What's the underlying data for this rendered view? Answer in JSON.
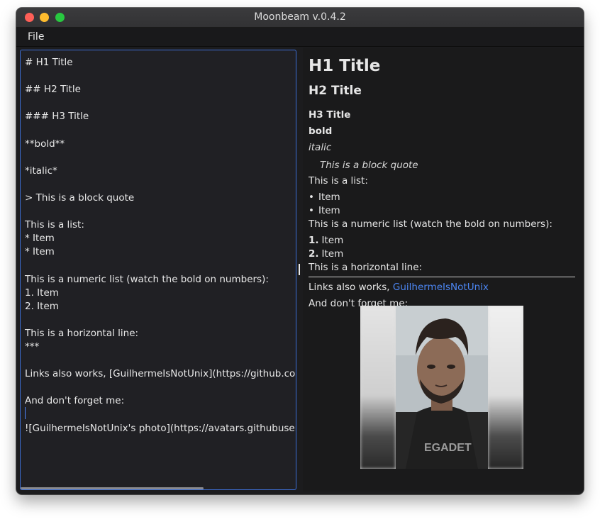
{
  "window": {
    "title": "Moonbeam v.0.4.2"
  },
  "menu": {
    "file": "File"
  },
  "editor": {
    "lines": [
      "# H1 Title",
      "",
      "## H2 Title",
      "",
      "### H3 Title",
      "",
      "**bold**",
      "",
      "*italic*",
      "",
      "> This is a block quote",
      "",
      "This is a list:",
      "* Item",
      "* Item",
      "",
      "This is a numeric list (watch the bold on numbers):",
      "1. Item",
      "2. Item",
      "",
      "This is a horizontal line:",
      "***",
      "",
      "Links also works, [GuilhermeIsNotUnix](https://github.com/GuilhermeIsNotUnix)",
      "",
      "And don't forget me:",
      "",
      "![GuilhermeIsNotUnix's photo](https://avatars.githubusercontent.com/GuilhermeIsNotUnix)"
    ]
  },
  "preview": {
    "h1": "H1 Title",
    "h2": "H2 Title",
    "h3": "H3 Title",
    "bold": "bold",
    "italic": "italic",
    "quote": "This is a block quote",
    "list_intro": "This is a list:",
    "list_items": [
      "Item",
      "Item"
    ],
    "bullet": "•",
    "numeric_intro": "This is a numeric list (watch the bold on numbers):",
    "numeric_items": [
      {
        "num": "1.",
        "text": "Item"
      },
      {
        "num": "2.",
        "text": "Item"
      }
    ],
    "hr_intro": "This is a horizontal line:",
    "links_prefix": "Links also works, ",
    "link_text": "GuilhermeIsNotUnix",
    "forget": "And don't forget me:",
    "image_alt": "GuilhermeIsNotUnix's photo"
  },
  "colors": {
    "accent": "#3d6fd6",
    "link": "#4c86f2",
    "editor_bg": "#202024",
    "preview_bg": "#1a1a1b"
  }
}
